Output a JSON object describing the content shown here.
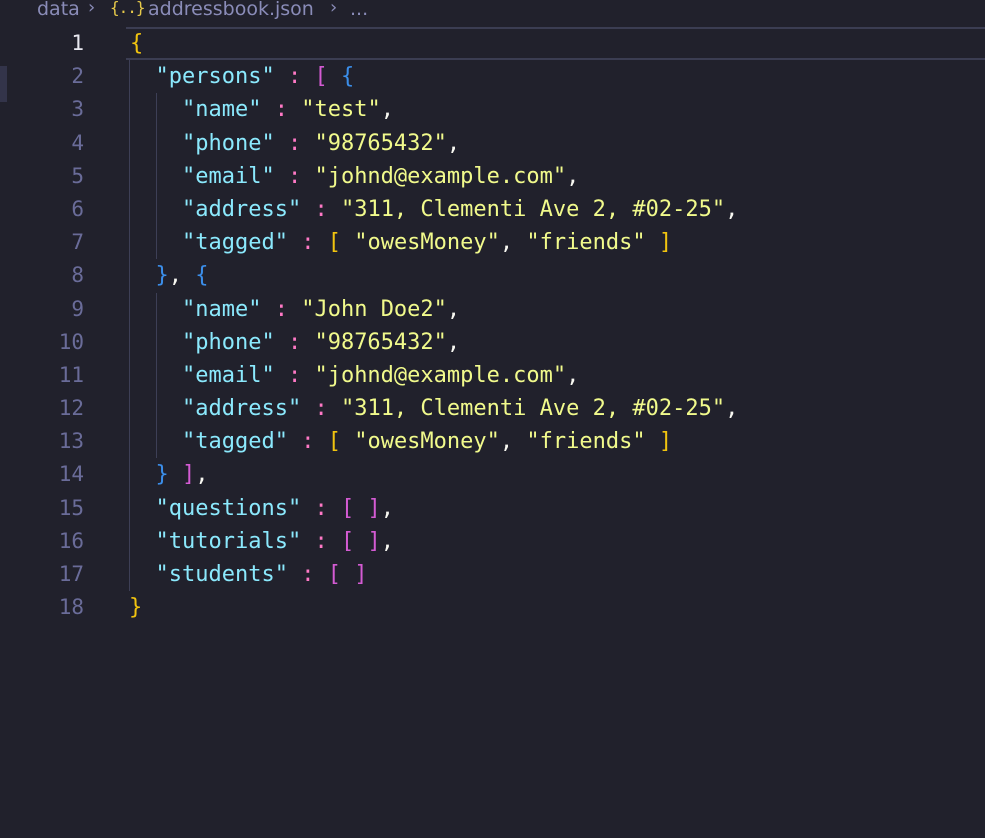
{
  "breadcrumb": {
    "folder": "data",
    "file_icon": "{..}",
    "file": "addressbook.json",
    "more": "..."
  },
  "lines": [
    {
      "n": "1",
      "tokens": [
        {
          "t": "{",
          "c": "yb"
        }
      ]
    },
    {
      "n": "2",
      "tokens": [
        {
          "t": "  ",
          "c": "w"
        },
        {
          "t": "\"persons\"",
          "c": "k"
        },
        {
          "t": " : ",
          "c": "p"
        },
        {
          "t": "[",
          "c": "pb"
        },
        {
          "t": " ",
          "c": "w"
        },
        {
          "t": "{",
          "c": "bb"
        }
      ]
    },
    {
      "n": "3",
      "tokens": [
        {
          "t": "    ",
          "c": "w"
        },
        {
          "t": "\"name\"",
          "c": "k"
        },
        {
          "t": " : ",
          "c": "p"
        },
        {
          "t": "\"test\"",
          "c": "s"
        },
        {
          "t": ",",
          "c": "w"
        }
      ]
    },
    {
      "n": "4",
      "tokens": [
        {
          "t": "    ",
          "c": "w"
        },
        {
          "t": "\"phone\"",
          "c": "k"
        },
        {
          "t": " : ",
          "c": "p"
        },
        {
          "t": "\"98765432\"",
          "c": "s"
        },
        {
          "t": ",",
          "c": "w"
        }
      ]
    },
    {
      "n": "5",
      "tokens": [
        {
          "t": "    ",
          "c": "w"
        },
        {
          "t": "\"email\"",
          "c": "k"
        },
        {
          "t": " : ",
          "c": "p"
        },
        {
          "t": "\"johnd@example.com\"",
          "c": "s"
        },
        {
          "t": ",",
          "c": "w"
        }
      ]
    },
    {
      "n": "6",
      "tokens": [
        {
          "t": "    ",
          "c": "w"
        },
        {
          "t": "\"address\"",
          "c": "k"
        },
        {
          "t": " : ",
          "c": "p"
        },
        {
          "t": "\"311, Clementi Ave 2, #02-25\"",
          "c": "s"
        },
        {
          "t": ",",
          "c": "w"
        }
      ]
    },
    {
      "n": "7",
      "tokens": [
        {
          "t": "    ",
          "c": "w"
        },
        {
          "t": "\"tagged\"",
          "c": "k"
        },
        {
          "t": " : ",
          "c": "p"
        },
        {
          "t": "[",
          "c": "yb"
        },
        {
          "t": " ",
          "c": "w"
        },
        {
          "t": "\"owesMoney\"",
          "c": "s"
        },
        {
          "t": ", ",
          "c": "w"
        },
        {
          "t": "\"friends\"",
          "c": "s"
        },
        {
          "t": " ",
          "c": "w"
        },
        {
          "t": "]",
          "c": "yb"
        }
      ]
    },
    {
      "n": "8",
      "tokens": [
        {
          "t": "  ",
          "c": "w"
        },
        {
          "t": "}",
          "c": "bb"
        },
        {
          "t": ", ",
          "c": "w"
        },
        {
          "t": "{",
          "c": "bb"
        }
      ]
    },
    {
      "n": "9",
      "tokens": [
        {
          "t": "    ",
          "c": "w"
        },
        {
          "t": "\"name\"",
          "c": "k"
        },
        {
          "t": " : ",
          "c": "p"
        },
        {
          "t": "\"John Doe2\"",
          "c": "s"
        },
        {
          "t": ",",
          "c": "w"
        }
      ]
    },
    {
      "n": "10",
      "tokens": [
        {
          "t": "    ",
          "c": "w"
        },
        {
          "t": "\"phone\"",
          "c": "k"
        },
        {
          "t": " : ",
          "c": "p"
        },
        {
          "t": "\"98765432\"",
          "c": "s"
        },
        {
          "t": ",",
          "c": "w"
        }
      ]
    },
    {
      "n": "11",
      "tokens": [
        {
          "t": "    ",
          "c": "w"
        },
        {
          "t": "\"email\"",
          "c": "k"
        },
        {
          "t": " : ",
          "c": "p"
        },
        {
          "t": "\"johnd@example.com\"",
          "c": "s"
        },
        {
          "t": ",",
          "c": "w"
        }
      ]
    },
    {
      "n": "12",
      "tokens": [
        {
          "t": "    ",
          "c": "w"
        },
        {
          "t": "\"address\"",
          "c": "k"
        },
        {
          "t": " : ",
          "c": "p"
        },
        {
          "t": "\"311, Clementi Ave 2, #02-25\"",
          "c": "s"
        },
        {
          "t": ",",
          "c": "w"
        }
      ]
    },
    {
      "n": "13",
      "tokens": [
        {
          "t": "    ",
          "c": "w"
        },
        {
          "t": "\"tagged\"",
          "c": "k"
        },
        {
          "t": " : ",
          "c": "p"
        },
        {
          "t": "[",
          "c": "yb"
        },
        {
          "t": " ",
          "c": "w"
        },
        {
          "t": "\"owesMoney\"",
          "c": "s"
        },
        {
          "t": ", ",
          "c": "w"
        },
        {
          "t": "\"friends\"",
          "c": "s"
        },
        {
          "t": " ",
          "c": "w"
        },
        {
          "t": "]",
          "c": "yb"
        }
      ]
    },
    {
      "n": "14",
      "tokens": [
        {
          "t": "  ",
          "c": "w"
        },
        {
          "t": "}",
          "c": "bb"
        },
        {
          "t": " ",
          "c": "w"
        },
        {
          "t": "]",
          "c": "pb"
        },
        {
          "t": ",",
          "c": "w"
        }
      ]
    },
    {
      "n": "15",
      "tokens": [
        {
          "t": "  ",
          "c": "w"
        },
        {
          "t": "\"questions\"",
          "c": "k"
        },
        {
          "t": " : ",
          "c": "p"
        },
        {
          "t": "[",
          "c": "pb"
        },
        {
          "t": " ",
          "c": "w"
        },
        {
          "t": "]",
          "c": "pb"
        },
        {
          "t": ",",
          "c": "w"
        }
      ]
    },
    {
      "n": "16",
      "tokens": [
        {
          "t": "  ",
          "c": "w"
        },
        {
          "t": "\"tutorials\"",
          "c": "k"
        },
        {
          "t": " : ",
          "c": "p"
        },
        {
          "t": "[",
          "c": "pb"
        },
        {
          "t": " ",
          "c": "w"
        },
        {
          "t": "]",
          "c": "pb"
        },
        {
          "t": ",",
          "c": "w"
        }
      ]
    },
    {
      "n": "17",
      "tokens": [
        {
          "t": "  ",
          "c": "w"
        },
        {
          "t": "\"students\"",
          "c": "k"
        },
        {
          "t": " : ",
          "c": "p"
        },
        {
          "t": "[",
          "c": "pb"
        },
        {
          "t": " ",
          "c": "w"
        },
        {
          "t": "]",
          "c": "pb"
        }
      ]
    },
    {
      "n": "18",
      "tokens": [
        {
          "t": "}",
          "c": "yb"
        }
      ]
    }
  ],
  "active_line": "1",
  "colors": {
    "background": "#21212c",
    "key": "#8be9fd",
    "string": "#f1fa8c",
    "punctuation": "#ff79c6",
    "bracket_level1": "#f1c40f",
    "bracket_level2": "#d45bd3",
    "bracket_level3": "#3b8eea",
    "line_number": "#6a6c99"
  }
}
